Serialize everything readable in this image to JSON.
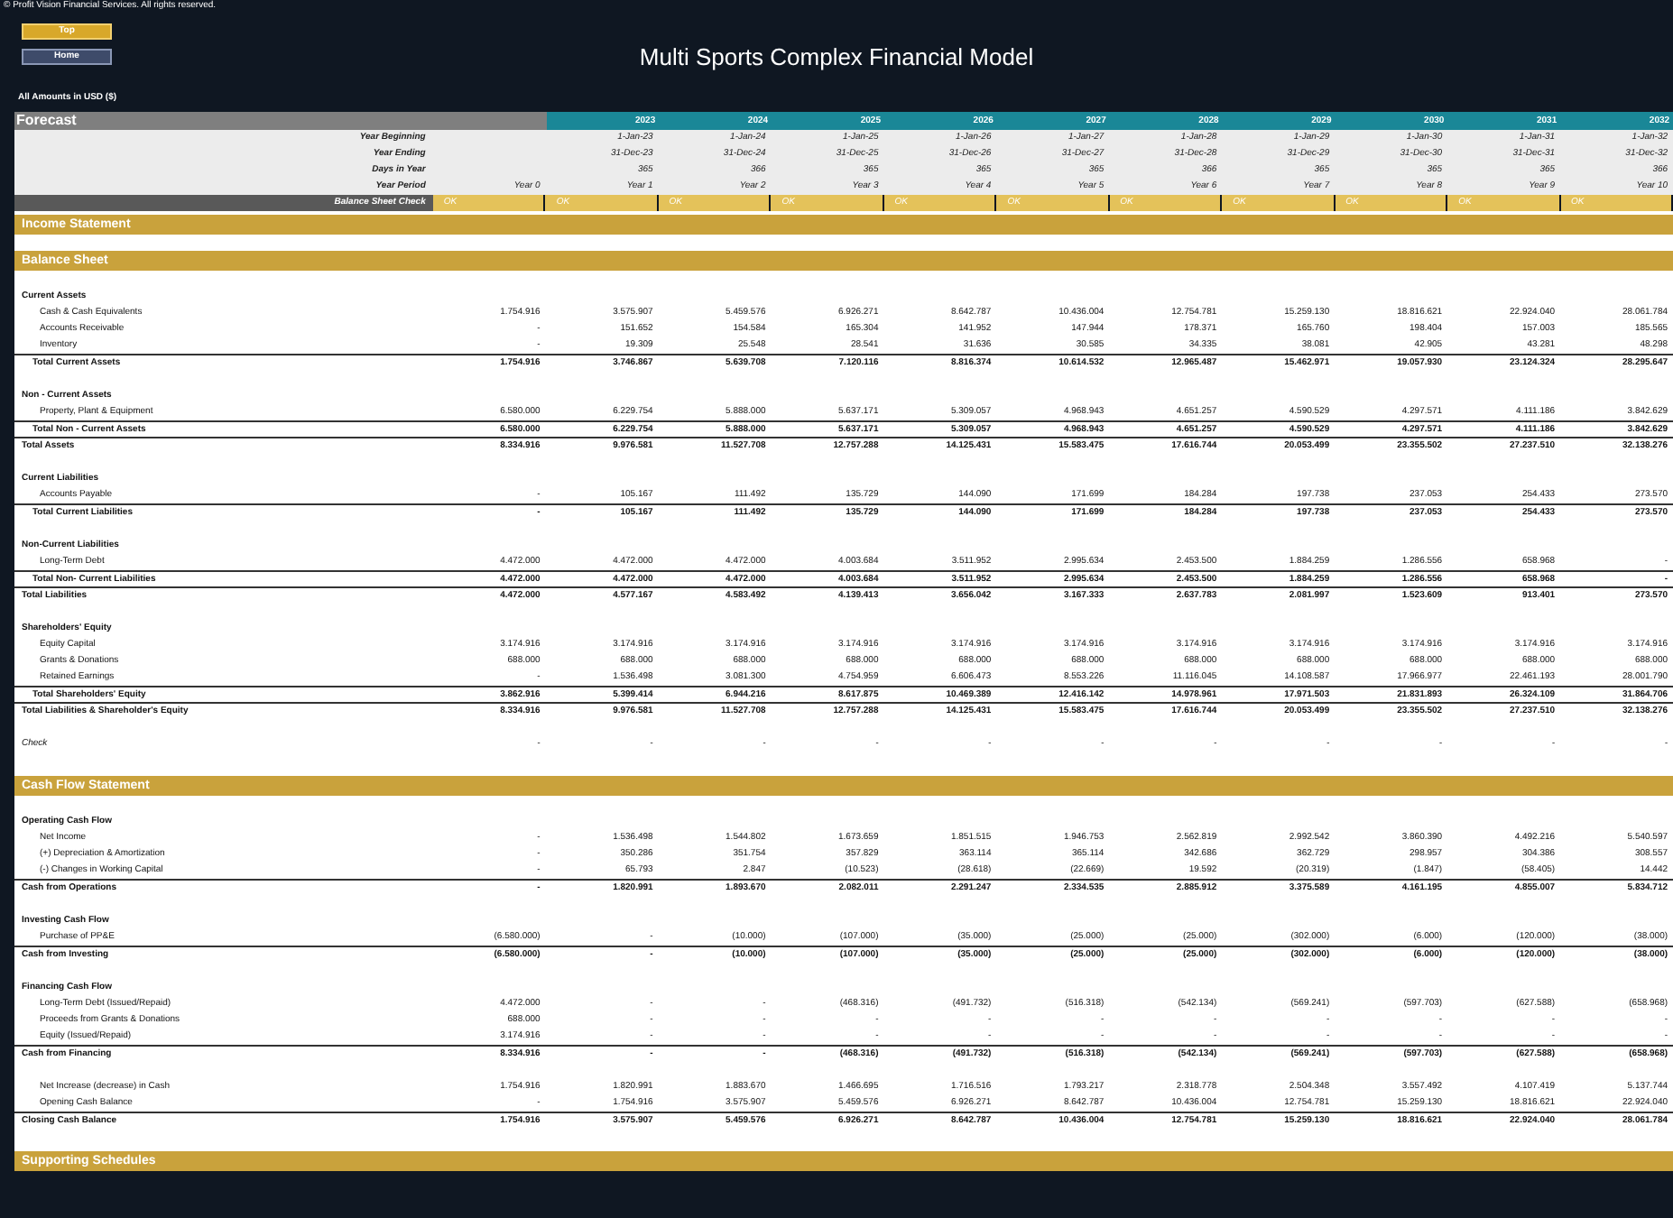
{
  "copyright": "© Profit Vision Financial Services. All rights reserved.",
  "nav_buttons": [
    {
      "label": "Top",
      "kind": "gold"
    },
    {
      "label": "Home",
      "kind": "slate"
    }
  ],
  "title": "Multi Sports Complex Financial Model",
  "currency_note": "All Amounts in USD ($)",
  "sheet": {
    "label": "Forecast",
    "years": [
      "2023",
      "2024",
      "2025",
      "2026",
      "2027",
      "2028",
      "2029",
      "2030",
      "2031",
      "2032"
    ],
    "header_rows": [
      {
        "label": "Year Beginning",
        "kind": "info",
        "values": [
          "1-Jan-23",
          "1-Jan-24",
          "1-Jan-25",
          "1-Jan-26",
          "1-Jan-27",
          "1-Jan-28",
          "1-Jan-29",
          "1-Jan-30",
          "1-Jan-31",
          "1-Jan-32"
        ]
      },
      {
        "label": "Year Ending",
        "kind": "info",
        "values": [
          "31-Dec-23",
          "31-Dec-24",
          "31-Dec-25",
          "31-Dec-26",
          "31-Dec-27",
          "31-Dec-28",
          "31-Dec-29",
          "31-Dec-30",
          "31-Dec-31",
          "31-Dec-32"
        ]
      },
      {
        "label": "Days in Year",
        "kind": "info",
        "values": [
          "365",
          "366",
          "365",
          "365",
          "365",
          "366",
          "365",
          "365",
          "365",
          "366"
        ]
      },
      {
        "label": "Year Period",
        "kind": "info",
        "year0": "Year 0",
        "values": [
          "Year 1",
          "Year 2",
          "Year 3",
          "Year 4",
          "Year 5",
          "Year 6",
          "Year 7",
          "Year 8",
          "Year 9",
          "Year 10"
        ]
      },
      {
        "label": "Balance Sheet Check",
        "kind": "check",
        "year0": "OK",
        "values": [
          "OK",
          "OK",
          "OK",
          "OK",
          "OK",
          "OK",
          "OK",
          "OK",
          "OK",
          "OK"
        ]
      }
    ],
    "sections": [
      {
        "title": "Income Statement"
      },
      {
        "title": "Balance Sheet",
        "groups": [
          {
            "rows": [
              {
                "kind": "heading",
                "label": "Current Assets"
              },
              {
                "kind": "item",
                "label": "Cash & Cash Equivalents",
                "values": [
                  "1.754.916",
                  "3.575.907",
                  "5.459.576",
                  "6.926.271",
                  "8.642.787",
                  "10.436.004",
                  "12.754.781",
                  "15.259.130",
                  "18.816.621",
                  "22.924.040",
                  "28.061.784"
                ]
              },
              {
                "kind": "item",
                "label": "Accounts Receivable",
                "values": [
                  "-",
                  "151.652",
                  "154.584",
                  "165.304",
                  "141.952",
                  "147.944",
                  "178.371",
                  "165.760",
                  "198.404",
                  "157.003",
                  "185.565"
                ]
              },
              {
                "kind": "item",
                "label": "Inventory",
                "values": [
                  "-",
                  "19.309",
                  "25.548",
                  "28.541",
                  "31.636",
                  "30.585",
                  "34.335",
                  "38.081",
                  "42.905",
                  "43.281",
                  "48.298"
                ]
              },
              {
                "kind": "subtotal",
                "label": "Total Current Assets",
                "values": [
                  "1.754.916",
                  "3.746.867",
                  "5.639.708",
                  "7.120.116",
                  "8.816.374",
                  "10.614.532",
                  "12.965.487",
                  "15.462.971",
                  "19.057.930",
                  "23.124.324",
                  "28.295.647"
                ]
              }
            ]
          },
          {
            "rows": [
              {
                "kind": "heading",
                "label": "Non - Current Assets"
              },
              {
                "kind": "item",
                "label": "Property, Plant & Equipment",
                "values": [
                  "6.580.000",
                  "6.229.754",
                  "5.888.000",
                  "5.637.171",
                  "5.309.057",
                  "4.968.943",
                  "4.651.257",
                  "4.590.529",
                  "4.297.571",
                  "4.111.186",
                  "3.842.629"
                ]
              },
              {
                "kind": "subtotal",
                "label": "Total Non - Current Assets",
                "values": [
                  "6.580.000",
                  "6.229.754",
                  "5.888.000",
                  "5.637.171",
                  "5.309.057",
                  "4.968.943",
                  "4.651.257",
                  "4.590.529",
                  "4.297.571",
                  "4.111.186",
                  "3.842.629"
                ]
              },
              {
                "kind": "total",
                "label": "Total Assets",
                "values": [
                  "8.334.916",
                  "9.976.581",
                  "11.527.708",
                  "12.757.288",
                  "14.125.431",
                  "15.583.475",
                  "17.616.744",
                  "20.053.499",
                  "23.355.502",
                  "27.237.510",
                  "32.138.276"
                ]
              }
            ]
          },
          {
            "rows": [
              {
                "kind": "heading",
                "label": "Current Liabilities"
              },
              {
                "kind": "item",
                "label": "Accounts Payable",
                "values": [
                  "-",
                  "105.167",
                  "111.492",
                  "135.729",
                  "144.090",
                  "171.699",
                  "184.284",
                  "197.738",
                  "237.053",
                  "254.433",
                  "273.570"
                ]
              },
              {
                "kind": "subtotal",
                "label": "Total Current Liabilities",
                "values": [
                  "-",
                  "105.167",
                  "111.492",
                  "135.729",
                  "144.090",
                  "171.699",
                  "184.284",
                  "197.738",
                  "237.053",
                  "254.433",
                  "273.570"
                ]
              }
            ]
          },
          {
            "rows": [
              {
                "kind": "heading",
                "label": "Non-Current Liabilities"
              },
              {
                "kind": "item",
                "label": "Long-Term Debt",
                "values": [
                  "4.472.000",
                  "4.472.000",
                  "4.472.000",
                  "4.003.684",
                  "3.511.952",
                  "2.995.634",
                  "2.453.500",
                  "1.884.259",
                  "1.286.556",
                  "658.968",
                  "-"
                ]
              },
              {
                "kind": "subtotal",
                "label": "Total Non- Current Liabilities",
                "values": [
                  "4.472.000",
                  "4.472.000",
                  "4.472.000",
                  "4.003.684",
                  "3.511.952",
                  "2.995.634",
                  "2.453.500",
                  "1.884.259",
                  "1.286.556",
                  "658.968",
                  "-"
                ]
              },
              {
                "kind": "total",
                "label": "Total Liabilities",
                "values": [
                  "4.472.000",
                  "4.577.167",
                  "4.583.492",
                  "4.139.413",
                  "3.656.042",
                  "3.167.333",
                  "2.637.783",
                  "2.081.997",
                  "1.523.609",
                  "913.401",
                  "273.570"
                ]
              }
            ]
          },
          {
            "rows": [
              {
                "kind": "heading",
                "label": "Shareholders' Equity"
              },
              {
                "kind": "item",
                "label": "Equity Capital",
                "values": [
                  "3.174.916",
                  "3.174.916",
                  "3.174.916",
                  "3.174.916",
                  "3.174.916",
                  "3.174.916",
                  "3.174.916",
                  "3.174.916",
                  "3.174.916",
                  "3.174.916",
                  "3.174.916"
                ]
              },
              {
                "kind": "item",
                "label": "Grants & Donations",
                "values": [
                  "688.000",
                  "688.000",
                  "688.000",
                  "688.000",
                  "688.000",
                  "688.000",
                  "688.000",
                  "688.000",
                  "688.000",
                  "688.000",
                  "688.000"
                ]
              },
              {
                "kind": "item",
                "label": "Retained Earnings",
                "values": [
                  "-",
                  "1.536.498",
                  "3.081.300",
                  "4.754.959",
                  "6.606.473",
                  "8.553.226",
                  "11.116.045",
                  "14.108.587",
                  "17.966.977",
                  "22.461.193",
                  "28.001.790"
                ]
              },
              {
                "kind": "subtotal",
                "label": "Total Shareholders' Equity",
                "values": [
                  "3.862.916",
                  "5.399.414",
                  "6.944.216",
                  "8.617.875",
                  "10.469.389",
                  "12.416.142",
                  "14.978.961",
                  "17.971.503",
                  "21.831.893",
                  "26.324.109",
                  "31.864.706"
                ]
              },
              {
                "kind": "total",
                "label": "Total Liabilities & Shareholder's Equity",
                "values": [
                  "8.334.916",
                  "9.976.581",
                  "11.527.708",
                  "12.757.288",
                  "14.125.431",
                  "15.583.475",
                  "17.616.744",
                  "20.053.499",
                  "23.355.502",
                  "27.237.510",
                  "32.138.276"
                ]
              }
            ]
          },
          {
            "rows": [
              {
                "kind": "check",
                "label": "Check",
                "values": [
                  "-",
                  "-",
                  "-",
                  "-",
                  "-",
                  "-",
                  "-",
                  "-",
                  "-",
                  "-",
                  "-"
                ]
              }
            ]
          }
        ]
      },
      {
        "title": "Cash Flow Statement",
        "groups": [
          {
            "rows": [
              {
                "kind": "heading",
                "label": "Operating Cash Flow"
              },
              {
                "kind": "item",
                "label": "Net Income",
                "values": [
                  "-",
                  "1.536.498",
                  "1.544.802",
                  "1.673.659",
                  "1.851.515",
                  "1.946.753",
                  "2.562.819",
                  "2.992.542",
                  "3.860.390",
                  "4.492.216",
                  "5.540.597"
                ]
              },
              {
                "kind": "item",
                "label": "(+) Depreciation & Amortization",
                "values": [
                  "-",
                  "350.286",
                  "351.754",
                  "357.829",
                  "363.114",
                  "365.114",
                  "342.686",
                  "362.729",
                  "298.957",
                  "304.386",
                  "308.557"
                ]
              },
              {
                "kind": "item",
                "label": "(-) Changes in Working Capital",
                "values": [
                  "-",
                  "65.793",
                  "2.847",
                  "(10.523)",
                  "(28.618)",
                  "(22.669)",
                  "19.592",
                  "(20.319)",
                  "(1.847)",
                  "(58.405)",
                  "14.442"
                ]
              },
              {
                "kind": "subtotal",
                "label": "Cash from Operations",
                "values": [
                  "-",
                  "1.820.991",
                  "1.893.670",
                  "2.082.011",
                  "2.291.247",
                  "2.334.535",
                  "2.885.912",
                  "3.375.589",
                  "4.161.195",
                  "4.855.007",
                  "5.834.712"
                ]
              }
            ]
          },
          {
            "rows": [
              {
                "kind": "heading",
                "label": "Investing Cash Flow"
              },
              {
                "kind": "item",
                "label": "Purchase of PP&E",
                "values": [
                  "(6.580.000)",
                  "-",
                  "(10.000)",
                  "(107.000)",
                  "(35.000)",
                  "(25.000)",
                  "(25.000)",
                  "(302.000)",
                  "(6.000)",
                  "(120.000)",
                  "(38.000)"
                ]
              },
              {
                "kind": "subtotal",
                "label": "Cash from Investing",
                "values": [
                  "(6.580.000)",
                  "-",
                  "(10.000)",
                  "(107.000)",
                  "(35.000)",
                  "(25.000)",
                  "(25.000)",
                  "(302.000)",
                  "(6.000)",
                  "(120.000)",
                  "(38.000)"
                ]
              }
            ]
          },
          {
            "rows": [
              {
                "kind": "heading",
                "label": "Financing Cash Flow"
              },
              {
                "kind": "item",
                "label": "Long-Term Debt (Issued/Repaid)",
                "values": [
                  "4.472.000",
                  "-",
                  "-",
                  "(468.316)",
                  "(491.732)",
                  "(516.318)",
                  "(542.134)",
                  "(569.241)",
                  "(597.703)",
                  "(627.588)",
                  "(658.968)"
                ]
              },
              {
                "kind": "item",
                "label": "Proceeds from Grants & Donations",
                "values": [
                  "688.000",
                  "-",
                  "-",
                  "-",
                  "-",
                  "-",
                  "-",
                  "-",
                  "-",
                  "-",
                  "-"
                ]
              },
              {
                "kind": "item",
                "label": "Equity (Issued/Repaid)",
                "values": [
                  "3.174.916",
                  "-",
                  "-",
                  "-",
                  "-",
                  "-",
                  "-",
                  "-",
                  "-",
                  "-",
                  "-"
                ]
              },
              {
                "kind": "subtotal",
                "label": "Cash from Financing",
                "values": [
                  "8.334.916",
                  "-",
                  "-",
                  "(468.316)",
                  "(491.732)",
                  "(516.318)",
                  "(542.134)",
                  "(569.241)",
                  "(597.703)",
                  "(627.588)",
                  "(658.968)"
                ]
              }
            ]
          },
          {
            "rows": [
              {
                "kind": "item",
                "label": "Net Increase (decrease) in Cash",
                "values": [
                  "1.754.916",
                  "1.820.991",
                  "1.883.670",
                  "1.466.695",
                  "1.716.516",
                  "1.793.217",
                  "2.318.778",
                  "2.504.348",
                  "3.557.492",
                  "4.107.419",
                  "5.137.744"
                ]
              },
              {
                "kind": "item",
                "label": "Opening Cash Balance",
                "values": [
                  "-",
                  "1.754.916",
                  "3.575.907",
                  "5.459.576",
                  "6.926.271",
                  "8.642.787",
                  "10.436.004",
                  "12.754.781",
                  "15.259.130",
                  "18.816.621",
                  "22.924.040"
                ]
              },
              {
                "kind": "subtotal",
                "label": "Closing Cash Balance",
                "values": [
                  "1.754.916",
                  "3.575.907",
                  "5.459.576",
                  "6.926.271",
                  "8.642.787",
                  "10.436.004",
                  "12.754.781",
                  "15.259.130",
                  "18.816.621",
                  "22.924.040",
                  "28.061.784"
                ]
              }
            ]
          }
        ]
      },
      {
        "title": "Supporting Schedules"
      }
    ]
  }
}
